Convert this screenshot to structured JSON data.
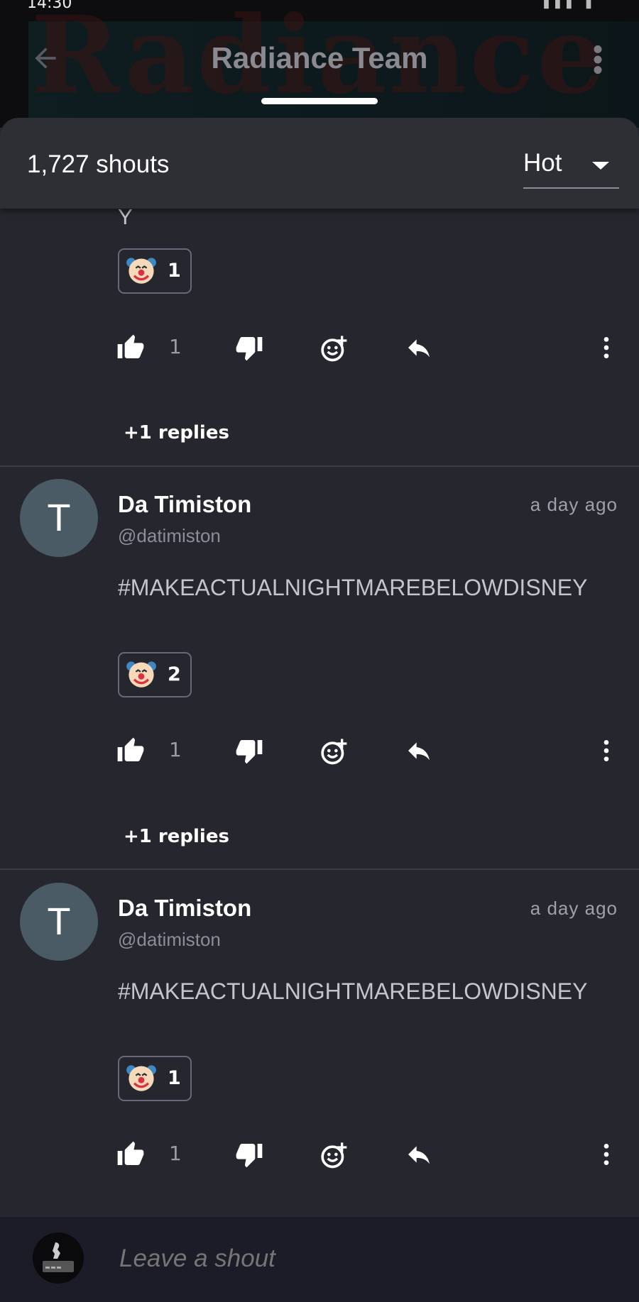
{
  "status_bar": {
    "time": "14:30"
  },
  "header": {
    "title": "Radiance Team",
    "background_watermark": "Radiance"
  },
  "feed_header": {
    "shout_count": "1,727 shouts",
    "sort": {
      "selected": "Hot"
    }
  },
  "posts": [
    {
      "partial": true,
      "text_tail": "Y",
      "reaction": {
        "emoji": "clown-face",
        "count": "1"
      },
      "likes": "1",
      "replies": "+1 replies"
    },
    {
      "avatar_letter": "T",
      "author": "Da Timiston",
      "handle": "@datimiston",
      "time": "a day ago",
      "text": "#MAKEACTUALNIGHTMAREBELOWDISNEY",
      "reaction": {
        "emoji": "clown-face",
        "count": "2"
      },
      "likes": "1",
      "replies": "+1 replies"
    },
    {
      "avatar_letter": "T",
      "author": "Da Timiston",
      "handle": "@datimiston",
      "time": "a day ago",
      "text": "#MAKEACTUALNIGHTMAREBELOWDISNEY",
      "reaction": {
        "emoji": "clown-face",
        "count": "1"
      },
      "likes": "1"
    }
  ],
  "composer": {
    "placeholder": "Leave a shout"
  },
  "colors": {
    "background": "#26262e",
    "header_bar": "#2e2e35",
    "composer": "#1c1b28",
    "avatar": "#4a5b66"
  }
}
